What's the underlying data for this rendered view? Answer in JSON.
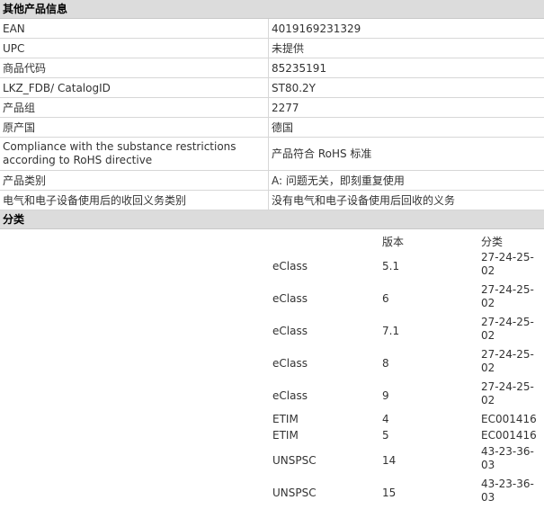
{
  "product_info": {
    "title": "其他产品信息",
    "rows": [
      {
        "key": "EAN",
        "value": "4019169231329"
      },
      {
        "key": "UPC",
        "value": "未提供"
      },
      {
        "key": "商品代码",
        "value": "85235191"
      },
      {
        "key": "LKZ_FDB/ CatalogID",
        "value": "ST80.2Y"
      },
      {
        "key": "产品组",
        "value": "2277"
      },
      {
        "key": "原产国",
        "value": "德国"
      },
      {
        "key": "Compliance with the substance restrictions according to RoHS directive",
        "value": "产品符合 RoHS 标准"
      },
      {
        "key": "产品类别",
        "value": "A: 问题无关，即刻重复使用"
      },
      {
        "key": "电气和电子设备使用后的收回义务类别",
        "value": "没有电气和电子设备使用后回收的义务"
      }
    ]
  },
  "classification": {
    "title": "分类",
    "headers": {
      "version": "版本",
      "class": "分类"
    },
    "rows": [
      {
        "system": "eClass",
        "version": "5.1",
        "class": "27-24-25-02"
      },
      {
        "system": "eClass",
        "version": "6",
        "class": "27-24-25-02"
      },
      {
        "system": "eClass",
        "version": "7.1",
        "class": "27-24-25-02"
      },
      {
        "system": "eClass",
        "version": "8",
        "class": "27-24-25-02"
      },
      {
        "system": "eClass",
        "version": "9",
        "class": "27-24-25-02"
      },
      {
        "system": "ETIM",
        "version": "4",
        "class": "EC001416"
      },
      {
        "system": "ETIM",
        "version": "5",
        "class": "EC001416"
      },
      {
        "system": "UNSPSC",
        "version": "14",
        "class": "43-23-36-03"
      },
      {
        "system": "UNSPSC",
        "version": "15",
        "class": "43-23-36-03"
      }
    ]
  }
}
